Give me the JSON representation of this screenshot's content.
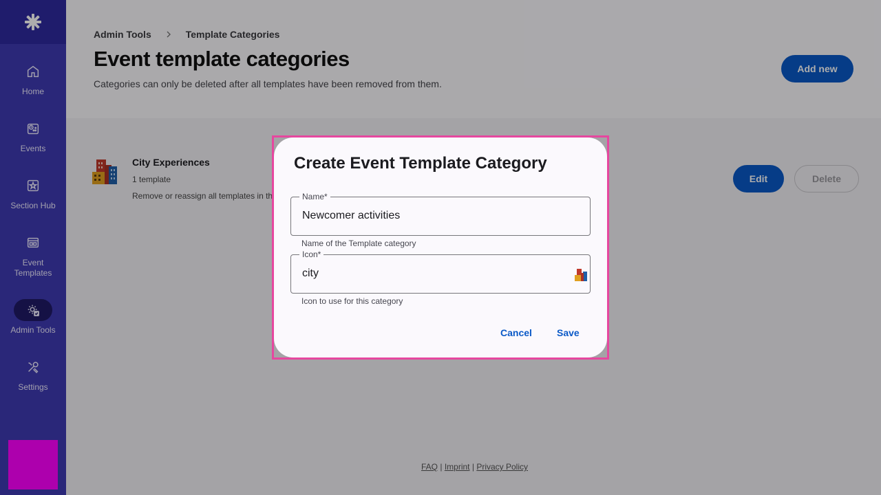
{
  "sidebar": {
    "logo_icon": "asterisk-logo",
    "items": [
      {
        "label": "Home",
        "icon": "home-icon"
      },
      {
        "label": "Events",
        "icon": "events-icon"
      },
      {
        "label": "Section Hub",
        "icon": "section-hub-icon"
      },
      {
        "label": "Event Templates",
        "icon": "event-templates-icon"
      },
      {
        "label": "Admin Tools",
        "icon": "admin-tools-icon",
        "active": true
      },
      {
        "label": "Settings",
        "icon": "settings-icon"
      }
    ]
  },
  "header": {
    "breadcrumb": [
      "Admin Tools",
      "Template Categories"
    ],
    "title": "Event template categories",
    "subtitle": "Categories can only be deleted after all templates have been removed from them.",
    "add_label": "Add new"
  },
  "categories": [
    {
      "name": "City Experiences",
      "count": "1 template",
      "note": "Remove or reassign all templates in th",
      "edit_label": "Edit",
      "delete_label": "Delete",
      "icon": "city-icon"
    }
  ],
  "footer": {
    "links": [
      "FAQ",
      "Imprint",
      "Privacy Policy"
    ],
    "separator": "|"
  },
  "dialog": {
    "title": "Create Event Template Category",
    "name_label": "Name*",
    "name_value": "Newcomer activities",
    "name_helper": "Name of the Template category",
    "icon_label": "Icon*",
    "icon_value": "city",
    "icon_helper": "Icon to use for this category",
    "cancel_label": "Cancel",
    "save_label": "Save"
  },
  "colors": {
    "sidebar": "#3e3ab3",
    "primary": "#0a59c7",
    "highlight": "#e6479f"
  }
}
